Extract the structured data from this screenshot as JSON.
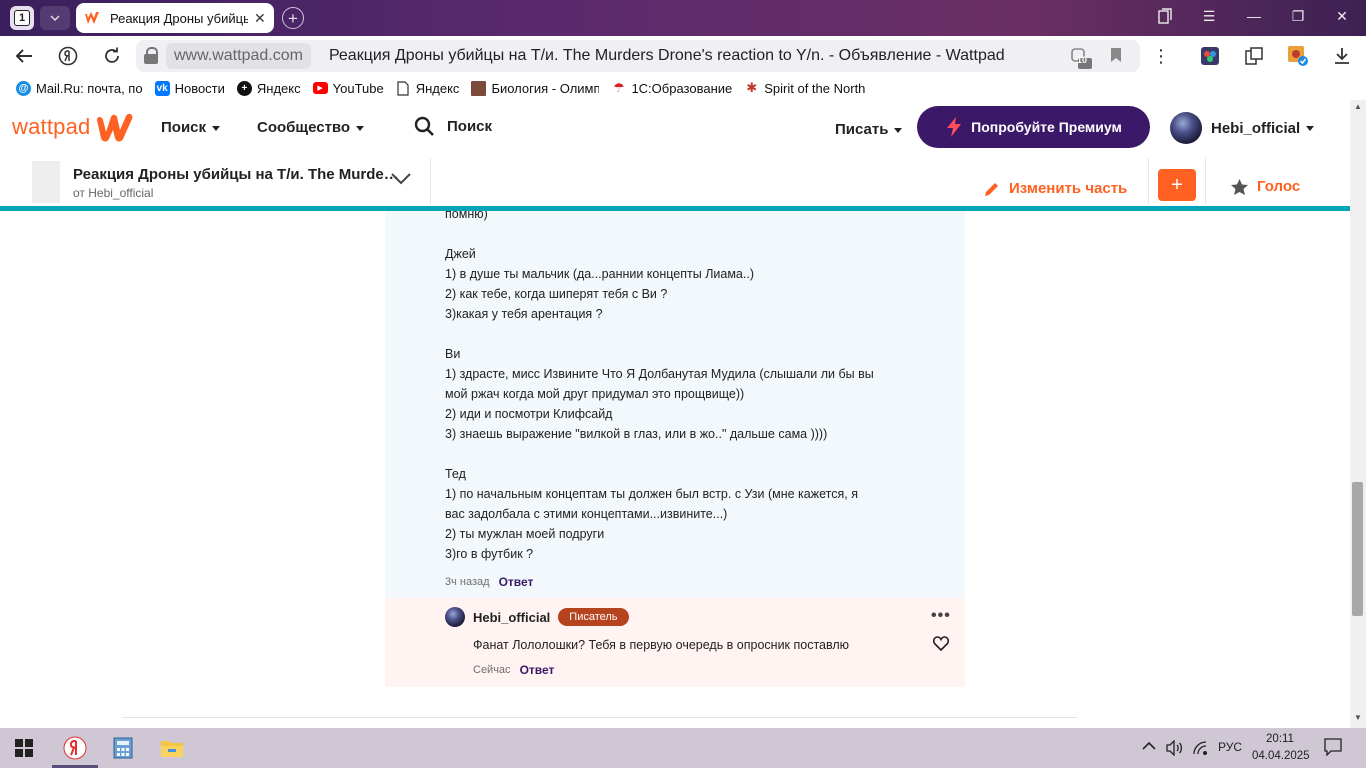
{
  "browser": {
    "tab_count": "1",
    "tab_title": "Реакция Дроны убийцы",
    "domain": "www.wattpad.com",
    "page_title": "Реакция Дроны убийцы на Т/и. The Murders Drone's reaction to Y/n. - Объявление - Wattpad",
    "badge_count": "10"
  },
  "bookmarks": [
    {
      "label": "Mail.Ru: почта, по",
      "icon": "mailru-icon",
      "color": "#168de2"
    },
    {
      "label": "Новости",
      "icon": "vk-icon",
      "color": "#0077ff"
    },
    {
      "label": "Яндекс",
      "icon": "yandex-plus-icon",
      "color": "#111111"
    },
    {
      "label": "YouTube",
      "icon": "youtube-icon",
      "color": "#ff0000"
    },
    {
      "label": "Яндекс",
      "icon": "document-icon",
      "color": "#555555"
    },
    {
      "label": "Биология - Олимп",
      "icon": "olymp-icon",
      "color": "#7a4a3a"
    },
    {
      "label": "1С:Образование",
      "icon": "1c-icon",
      "color": "#d62020"
    },
    {
      "label": "Spirit of the North",
      "icon": "spirit-icon",
      "color": "#c0392b"
    }
  ],
  "wattpad": {
    "logo": "wattpad",
    "nav_search_menu": "Поиск",
    "nav_community": "Сообщество",
    "search_label": "Поиск",
    "write": "Писать",
    "premium": "Попробуйте Премиум",
    "username": "Hebi_official",
    "brand_color": "#ff6122",
    "premium_color": "#3b1968"
  },
  "story": {
    "title": "Реакция Дроны убийцы на Т/и. The Murders Drone's reaction to Y/n.",
    "author": "от Hebi_official",
    "edit_part": "Изменить часть",
    "add": "+",
    "vote": "Голос"
  },
  "comment": {
    "lines": [
      "помню)",
      "",
      "Джей",
      "1) в душе ты мальчик (да...раннии концепты Лиама..)",
      "2) как тебе, когда шиперят тебя с Ви ?",
      "3)какая у тебя арентация ?",
      "",
      "Ви",
      "1) здрасте, мисс Извините Что Я Долбанутая Мудила  (слышали ли бы вы",
      "мой ржач когда мой друг придумал это прощвище))",
      "2) иди и посмотри Клифсайд",
      "3) знаешь выражение \"вилкой в глаз, или в жо..\" дальше сама ))))",
      "",
      "Тед",
      "1) по начальным концептам ты должен был встр. с Узи  (мне кажется, я",
      "вас задолбала с этими концептами...извините...)",
      "2) ты мужлан моей подруги",
      "3)го в футбик  ?"
    ],
    "time": "3ч назад",
    "reply": "Ответ"
  },
  "reply": {
    "author": "Hebi_official",
    "badge": "Писатель",
    "text": "Фанат Лололошки? Тебя в первую очередь в опросник поставлю",
    "time": "Сейчас",
    "reply": "Ответ"
  },
  "taskbar": {
    "lang": "РУС",
    "time": "20:11",
    "date": "04.04.2025"
  }
}
